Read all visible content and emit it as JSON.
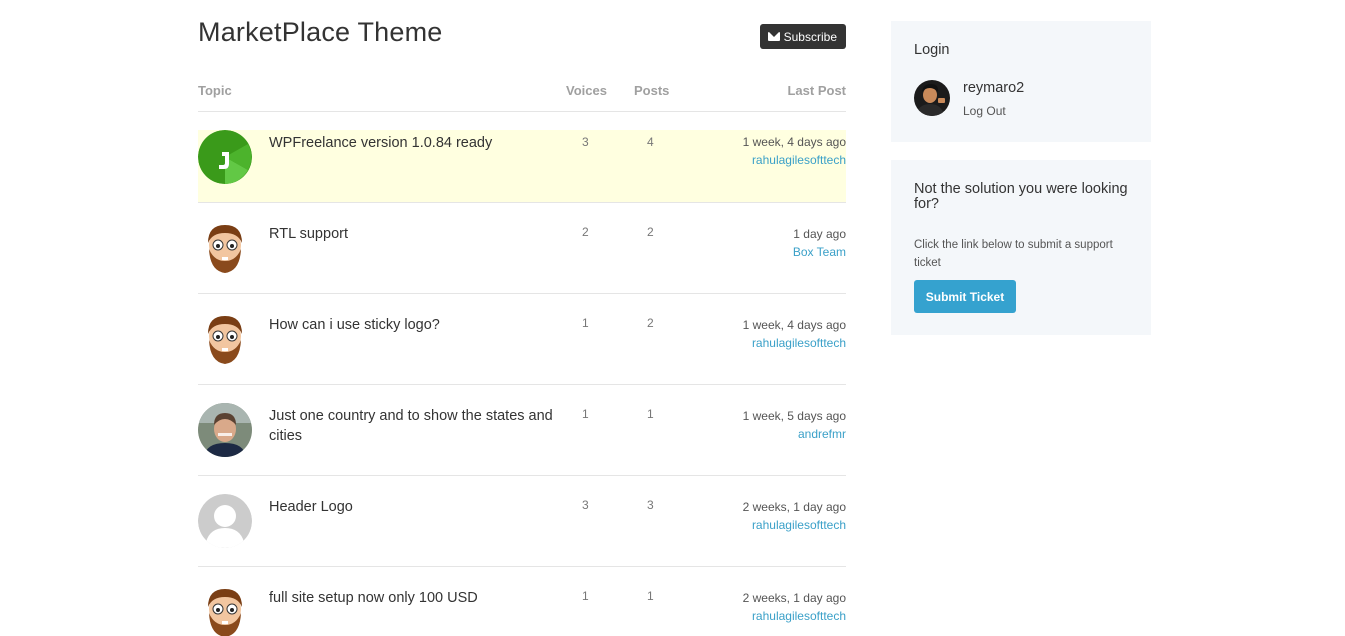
{
  "forum": {
    "title": "MarketPlace Theme",
    "subscribe_label": "Subscribe"
  },
  "table_headers": {
    "topic": "Topic",
    "voices": "Voices",
    "posts": "Posts",
    "last_post": "Last Post"
  },
  "topics": [
    {
      "title": "WPFreelance version 1.0.84 ready",
      "voices": "3",
      "posts": "4",
      "time": "1 week, 4 days ago",
      "author": "rahulagilesofttech",
      "avatar": "wpfreelance-logo",
      "sticky": true
    },
    {
      "title": "RTL support",
      "voices": "2",
      "posts": "2",
      "time": "1 day ago",
      "author": "Box Team",
      "avatar": "cartoon-beard-avatar"
    },
    {
      "title": "How can i use sticky logo?",
      "voices": "1",
      "posts": "2",
      "time": "1 week, 4 days ago",
      "author": "rahulagilesofttech",
      "avatar": "cartoon-beard-avatar"
    },
    {
      "title": "Just one country and to show the states and cities",
      "voices": "1",
      "posts": "1",
      "time": "1 week, 5 days ago",
      "author": "andrefmr",
      "avatar": "photo-avatar"
    },
    {
      "title": "Header Logo",
      "voices": "3",
      "posts": "3",
      "time": "2 weeks, 1 day ago",
      "author": "rahulagilesofttech",
      "avatar": "default-user-avatar"
    },
    {
      "title": "full site setup now only 100 USD",
      "voices": "1",
      "posts": "1",
      "time": "2 weeks, 1 day ago",
      "author": "rahulagilesofttech",
      "avatar": "cartoon-beard-avatar"
    }
  ],
  "login_widget": {
    "title": "Login",
    "username": "reymaro2",
    "logout_label": "Log Out"
  },
  "support_widget": {
    "title": "Not the solution you were looking for?",
    "text": "Click the link below to submit a support ticket",
    "button_label": "Submit Ticket"
  },
  "colors": {
    "link": "#3aa0c8",
    "button": "#35a2cf",
    "sticky_bg": "#ffffe0",
    "sidebar_bg": "#f4f7fa"
  }
}
